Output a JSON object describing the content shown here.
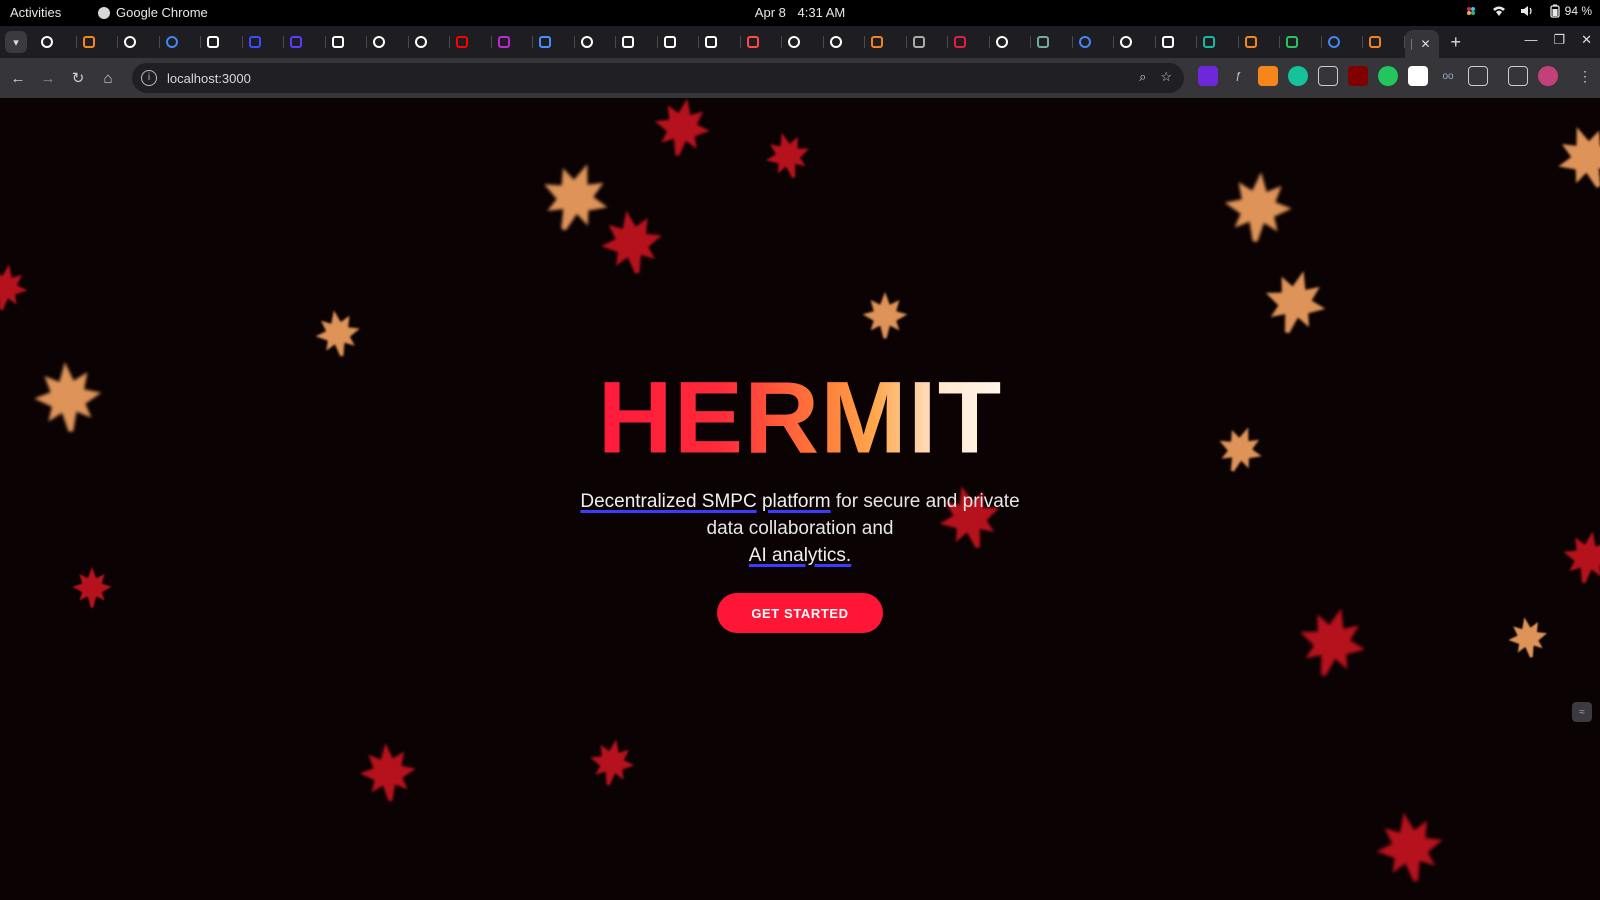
{
  "system_bar": {
    "activities": "Activities",
    "app_name": "Google Chrome",
    "date": "Apr 8",
    "time": "4:31 AM",
    "battery": "94 %"
  },
  "browser": {
    "tab_favicons": [
      {
        "icon": "github-icon",
        "color": "#ffffff"
      },
      {
        "icon": "metamask-icon",
        "color": "#f6851b"
      },
      {
        "icon": "github-icon",
        "color": "#ffffff"
      },
      {
        "icon": "google-icon",
        "color": "#4285f4"
      },
      {
        "icon": "triangle-icon",
        "color": "#ffffff"
      },
      {
        "icon": "q-icon",
        "color": "#3b4bff"
      },
      {
        "icon": "square-icon",
        "color": "#5a3bff"
      },
      {
        "icon": "w-icon",
        "color": "#ffffff"
      },
      {
        "icon": "github-icon",
        "color": "#ffffff"
      },
      {
        "icon": "github-icon",
        "color": "#ffffff"
      },
      {
        "icon": "youtube-icon",
        "color": "#ff0000"
      },
      {
        "icon": "m-icon",
        "color": "#c026d3"
      },
      {
        "icon": "photo-icon",
        "color": "#4a8cff"
      },
      {
        "icon": "github-icon",
        "color": "#ffffff"
      },
      {
        "icon": "dots-icon",
        "color": "#ffffff"
      },
      {
        "icon": "triangle-icon",
        "color": "#ffffff"
      },
      {
        "icon": "triangle-icon",
        "color": "#ffffff"
      },
      {
        "icon": "doc-icon",
        "color": "#ff4a4a"
      },
      {
        "icon": "github-icon",
        "color": "#ffffff"
      },
      {
        "icon": "github-icon",
        "color": "#ffffff"
      },
      {
        "icon": "stackoverflow-icon",
        "color": "#f48024"
      },
      {
        "icon": "globe-icon",
        "color": "#aaaaaa"
      },
      {
        "icon": "record-icon",
        "color": "#e11d48"
      },
      {
        "icon": "github-icon",
        "color": "#ffffff"
      },
      {
        "icon": "chatgpt-icon",
        "color": "#74aa9c"
      },
      {
        "icon": "google-icon",
        "color": "#4285f4"
      },
      {
        "icon": "github-icon",
        "color": "#ffffff"
      },
      {
        "icon": "triangle-icon",
        "color": "#ffffff"
      },
      {
        "icon": "m-circle-icon",
        "color": "#14b8a6"
      },
      {
        "icon": "metamask-icon",
        "color": "#f6851b"
      },
      {
        "icon": "w-icon",
        "color": "#22c55e"
      },
      {
        "icon": "google-icon",
        "color": "#4285f4"
      },
      {
        "icon": "stackoverflow-icon",
        "color": "#f48024"
      }
    ],
    "address": "localhost:3000"
  },
  "hero": {
    "title": "HERMIT",
    "tagline_part1": "Decentralized SMPC",
    "tagline_part2": "platform",
    "tagline_part3": " for secure and private data collaboration and ",
    "tagline_part4": "AI analytics.",
    "cta_label": "GET STARTED"
  },
  "colors": {
    "accent": "#ff1636",
    "leaf_red": "#c81420",
    "leaf_orange": "#f0a060",
    "underline": "#3b3bff"
  }
}
